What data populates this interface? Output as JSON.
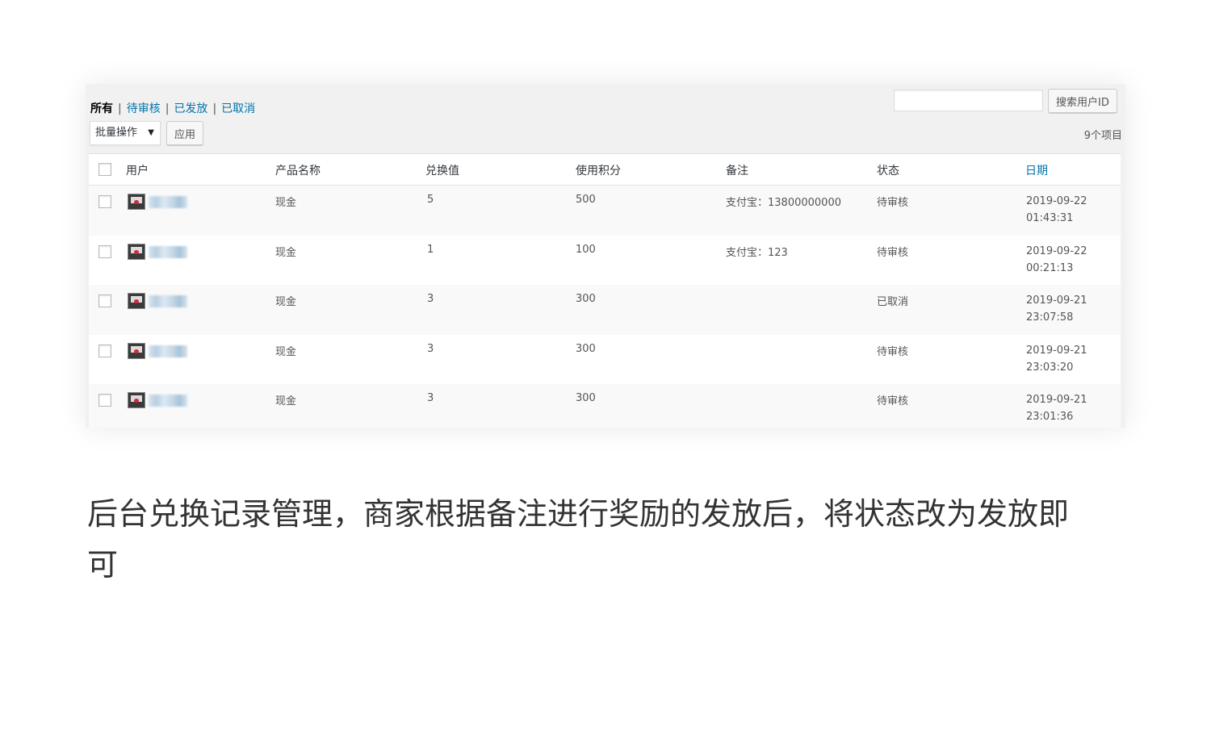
{
  "filters": [
    {
      "label": "所有",
      "current": true
    },
    {
      "label": "待审核",
      "current": false
    },
    {
      "label": "已发放",
      "current": false
    },
    {
      "label": "已取消",
      "current": false
    }
  ],
  "filter_separator": "|",
  "search": {
    "value": "",
    "button_label": "搜索用户ID"
  },
  "bulk_actions": {
    "selected": "批量操作",
    "apply_label": "应用"
  },
  "items_count": "9个项目",
  "table": {
    "columns": {
      "user": "用户",
      "product": "产品名称",
      "value": "兑换值",
      "points": "使用积分",
      "note": "备注",
      "status": "状态",
      "date": "日期"
    },
    "rows": [
      {
        "product": "现金",
        "value": "5",
        "points": "500",
        "note": "支付宝：13800000000",
        "status": "待审核",
        "date": "2019-09-22",
        "time": "01:43:31"
      },
      {
        "product": "现金",
        "value": "1",
        "points": "100",
        "note": "支付宝：123",
        "status": "待审核",
        "date": "2019-09-22",
        "time": "00:21:13"
      },
      {
        "product": "现金",
        "value": "3",
        "points": "300",
        "note": "",
        "status": "已取消",
        "date": "2019-09-21",
        "time": "23:07:58"
      },
      {
        "product": "现金",
        "value": "3",
        "points": "300",
        "note": "",
        "status": "待审核",
        "date": "2019-09-21",
        "time": "23:03:20"
      },
      {
        "product": "现金",
        "value": "3",
        "points": "300",
        "note": "",
        "status": "待审核",
        "date": "2019-09-21",
        "time": "23:01:36"
      }
    ]
  },
  "caption": "后台兑换记录管理，商家根据备注进行奖励的发放后，将状态改为发放即可",
  "colors": {
    "link": "#0073aa",
    "text": "#32373c",
    "background": "#f1f1f1"
  }
}
